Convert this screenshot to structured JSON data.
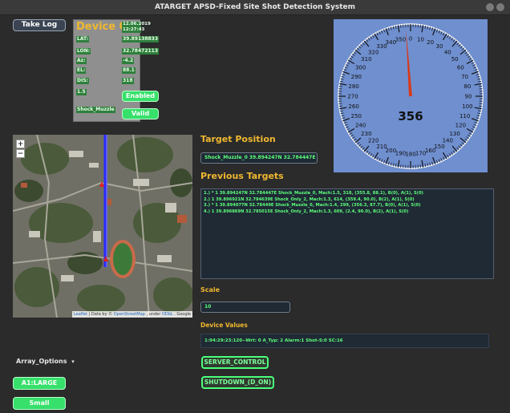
{
  "window": {
    "title": "ATARGET APSD-Fixed Site Shot Detection System"
  },
  "toolbar": {
    "take_log_label": "Take Log"
  },
  "device": {
    "name": "Device 0",
    "date": "12.06.2019",
    "time": "12:27:43",
    "rows": [
      {
        "label": "LAT:",
        "value": "39.89138833"
      },
      {
        "label": "LON:",
        "value": "32.78472113"
      },
      {
        "label": "Az:",
        "value": "-4.2"
      },
      {
        "label": "EL:",
        "value": "88.1"
      },
      {
        "label": "DIS:",
        "value": "318"
      }
    ],
    "mach": "1.5",
    "enabled_label": "Enabled",
    "shot_type": "Shock_Muzzle",
    "valid_label": "Valid"
  },
  "gauge": {
    "value": 356,
    "value_text": "356",
    "ticks": [
      "0",
      "10",
      "20",
      "30",
      "40",
      "50",
      "60",
      "70",
      "80",
      "90",
      "100",
      "110",
      "120",
      "130",
      "140",
      "150",
      "160",
      "170",
      "180",
      "190",
      "200",
      "210",
      "220",
      "230",
      "240",
      "250",
      "260",
      "270",
      "280",
      "290",
      "300",
      "310",
      "320",
      "330",
      "340",
      "350"
    ],
    "face_color": "#6f8fcf",
    "needle_color": "#d83a1a"
  },
  "map": {
    "zoom_in": "+",
    "zoom_out": "−",
    "attribution": {
      "leaflet": "Leaflet",
      "data_by": "| Data by ©",
      "osm": "OpenStreetMap",
      "under": ", under",
      "odbl": "ODbL",
      "google": ". Google"
    }
  },
  "target_position": {
    "heading": "Target Position",
    "value": "Shock_Muzzle_0 39.894247N  32.784447E"
  },
  "previous_targets": {
    "heading": "Previous Targets",
    "lines": [
      "1.) *  1  39.894247N  32.784447E Shock_Muzzle_0, Mach:1.5, 318, (355.8, 88.1), B(0), A(1), S(0)",
      "2.)    1  39.896921N  32.784639E Shock_Only_2, Mach:1.3, 614, (359.4, 90.0), B(2), A(1), S(0)",
      "3.) *  1  39.894077N  32.78449E Shock_Muzzle_0, Mach:1.4, 299, (356.3, 87.7), B(0), A(1), S(0)",
      "4.)    1  39.896869N  32.785015E Shock_Only_2, Mach:1.3, 609, (2.4, 90.0), B(2), A(1), S(0)"
    ]
  },
  "scale": {
    "heading": "Scale",
    "value": "10"
  },
  "device_values": {
    "heading": "Device Values",
    "value": "1:94:29:23:120--Wrt: 0  A_Typ: 2 Alarm:1 Shot-S:0 SC:16"
  },
  "array_options": {
    "label": "Array_Options",
    "arrow": "▾",
    "selected": "A1:LARGE",
    "small_label": "Small"
  },
  "controls": {
    "server_control_label": "SERVER_CONTROL",
    "shutdown_label": "SHUTDOWN_(D_ON)"
  }
}
